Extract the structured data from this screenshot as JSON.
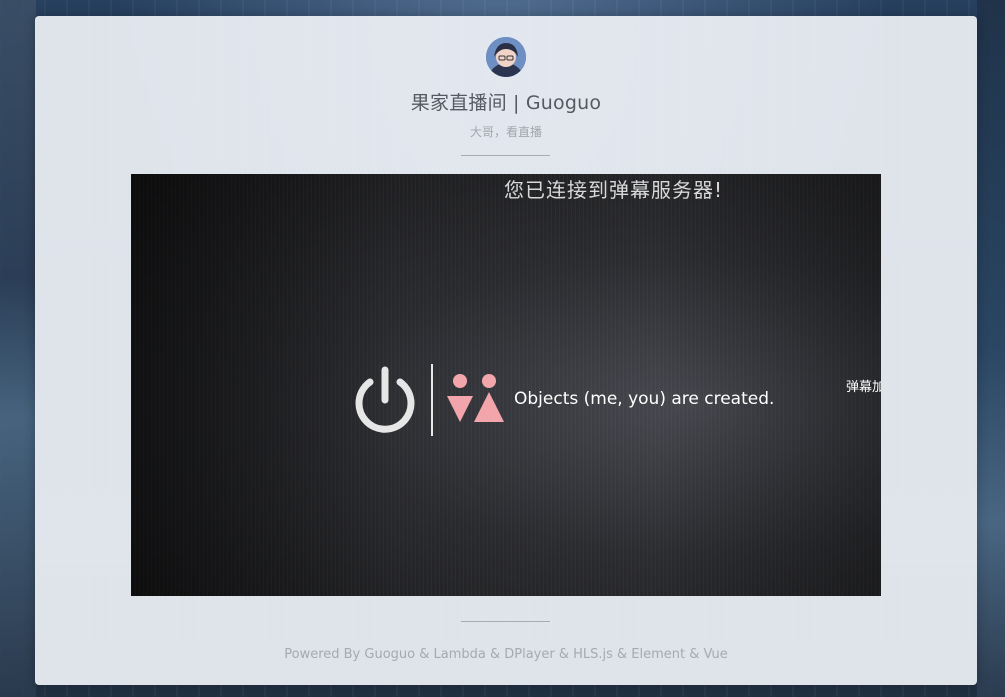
{
  "header": {
    "title": "果家直播间 | Guoguo",
    "subtitle": "大哥，看直播"
  },
  "player": {
    "danmaku_top": "您已连接到弹幕服务器!",
    "danmaku_right": "弹幕加",
    "overlay_text": "Objects (me, you) are created.",
    "icons": [
      "power-icon",
      "people-icon"
    ]
  },
  "footer": {
    "text": "Powered By Guoguo & Lambda & DPlayer & HLS.js & Element & Vue"
  },
  "colors": {
    "card": "#eef1f6",
    "people_icon": "#f2a6ac",
    "power_icon": "#e6e6e6"
  }
}
